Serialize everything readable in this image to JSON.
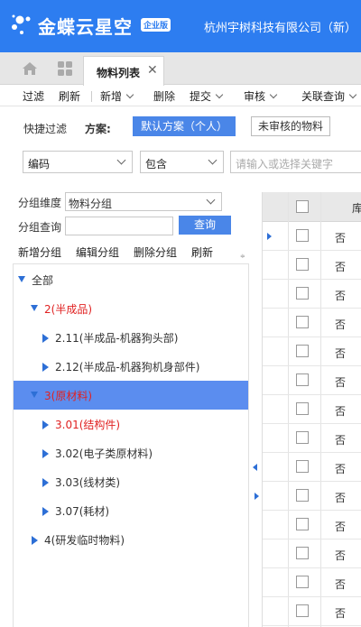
{
  "header": {
    "brand": "金蝶云星空",
    "edition_badge": "企业版",
    "company": "杭州宇树科技有限公司（新）"
  },
  "tabs": {
    "active_label": "物料列表",
    "close_glyph": "✕"
  },
  "toolbar": {
    "filter": "过滤",
    "refresh": "刷新",
    "add": "新增",
    "delete": "删除",
    "submit": "提交",
    "audit": "审核",
    "related_query": "关联查询"
  },
  "quick_filter": {
    "label": "快捷过滤",
    "scheme_label": "方案:",
    "default_scheme": "默认方案（个人）",
    "unaudited": "未审核的物料"
  },
  "filter_row": {
    "field": "编码",
    "operator": "包含",
    "keyword_placeholder": "请输入或选择关键字"
  },
  "group_panel": {
    "dimension_label": "分组维度",
    "dimension_value": "物料分组",
    "query_label": "分组查询",
    "query_button": "查询",
    "add_group": "新增分组",
    "edit_group": "编辑分组",
    "delete_group": "删除分组",
    "refresh": "刷新",
    "more_glyph": "≑"
  },
  "tree": [
    {
      "label": "全部",
      "level": 0,
      "expanded": true,
      "color": "normal"
    },
    {
      "label": "2(半成品)",
      "level": 1,
      "expanded": true,
      "color": "red"
    },
    {
      "label": "2.11(半成品-机器狗头部)",
      "level": 2,
      "expanded": false,
      "color": "normal"
    },
    {
      "label": "2.12(半成品-机器狗机身部件)",
      "level": 2,
      "expanded": false,
      "color": "normal"
    },
    {
      "label": "3(原材料)",
      "level": 1,
      "expanded": true,
      "color": "red",
      "selected": true
    },
    {
      "label": "3.01(结构件)",
      "level": 2,
      "expanded": false,
      "color": "red"
    },
    {
      "label": "3.02(电子类原材料)",
      "level": 2,
      "expanded": false,
      "color": "normal"
    },
    {
      "label": "3.03(线材类)",
      "level": 2,
      "expanded": false,
      "color": "normal"
    },
    {
      "label": "3.07(耗材)",
      "level": 2,
      "expanded": false,
      "color": "normal"
    },
    {
      "label": "4(研发临时物料)",
      "level": 1,
      "expanded": false,
      "color": "normal"
    }
  ],
  "grid": {
    "header_partial": "库",
    "rows": [
      "否",
      "否",
      "否",
      "否",
      "否",
      "否",
      "否",
      "否",
      "否",
      "否",
      "否",
      "否",
      "否",
      "否"
    ]
  },
  "colors": {
    "brand_blue": "#2d7df0",
    "button_blue": "#4a86e8",
    "selected_row": "#5b8def",
    "tree_red": "#e02222"
  }
}
